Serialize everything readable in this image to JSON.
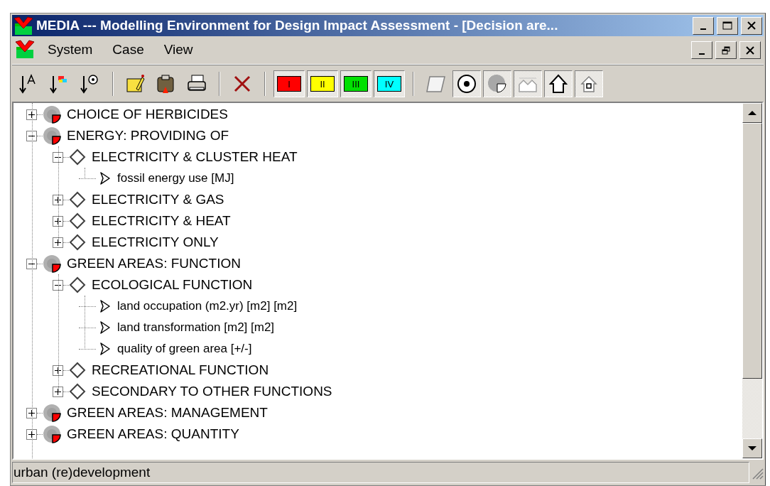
{
  "window": {
    "title": "MEDIA --- Modelling Environment for Design Impact Assessment - [Decision are..."
  },
  "menu": [
    {
      "label": "System"
    },
    {
      "label": "Case"
    },
    {
      "label": "View"
    }
  ],
  "toolbar": [
    {
      "kind": "sort-name",
      "pressed": false
    },
    {
      "kind": "sort-color",
      "pressed": false
    },
    {
      "kind": "sort-target",
      "pressed": false
    },
    {
      "kind": "separator"
    },
    {
      "kind": "edit",
      "pressed": false
    },
    {
      "kind": "paste",
      "pressed": false
    },
    {
      "kind": "print",
      "pressed": false
    },
    {
      "kind": "separator"
    },
    {
      "kind": "delete",
      "pressed": false
    },
    {
      "kind": "separator"
    },
    {
      "kind": "level",
      "label": "I",
      "color": "#ff0000",
      "pressed": true
    },
    {
      "kind": "level",
      "label": "II",
      "color": "#ffff00",
      "pressed": true
    },
    {
      "kind": "level",
      "label": "III",
      "color": "#00e000",
      "pressed": true
    },
    {
      "kind": "level",
      "label": "IV",
      "color": "#00ffff",
      "pressed": true
    },
    {
      "kind": "separator"
    },
    {
      "kind": "sheet",
      "pressed": false
    },
    {
      "kind": "target",
      "pressed": true
    },
    {
      "kind": "pie",
      "pressed": true
    },
    {
      "kind": "hills",
      "pressed": true
    },
    {
      "kind": "house",
      "pressed": true
    },
    {
      "kind": "house-small",
      "pressed": true
    }
  ],
  "tree": [
    {
      "kind": "group",
      "label": "CHOICE OF HERBICIDES",
      "expanded": false
    },
    {
      "kind": "group",
      "label": "ENERGY: PROVIDING OF",
      "expanded": true,
      "children": [
        {
          "kind": "option",
          "label": "ELECTRICITY & CLUSTER HEAT",
          "expanded": true,
          "children": [
            {
              "kind": "criterion",
              "label": "fossil energy use [MJ]"
            }
          ]
        },
        {
          "kind": "option",
          "label": "ELECTRICITY & GAS",
          "expanded": false
        },
        {
          "kind": "option",
          "label": "ELECTRICITY & HEAT",
          "expanded": false
        },
        {
          "kind": "option",
          "label": "ELECTRICITY ONLY",
          "expanded": false
        }
      ]
    },
    {
      "kind": "group",
      "label": "GREEN AREAS: FUNCTION",
      "expanded": true,
      "children": [
        {
          "kind": "option",
          "label": "ECOLOGICAL FUNCTION",
          "expanded": true,
          "children": [
            {
              "kind": "criterion",
              "label": "land occupation (m2.yr) [m2] [m2]"
            },
            {
              "kind": "criterion",
              "label": "land transformation [m2] [m2]"
            },
            {
              "kind": "criterion",
              "label": "quality of green area [+/-]"
            }
          ]
        },
        {
          "kind": "option",
          "label": "RECREATIONAL FUNCTION",
          "expanded": false
        },
        {
          "kind": "option",
          "label": "SECONDARY TO OTHER FUNCTIONS",
          "expanded": false
        }
      ]
    },
    {
      "kind": "group",
      "label": "GREEN AREAS: MANAGEMENT",
      "expanded": false
    },
    {
      "kind": "group",
      "label": "GREEN AREAS: QUANTITY",
      "expanded": false
    }
  ],
  "status_bar": {
    "text": "urban (re)development"
  }
}
